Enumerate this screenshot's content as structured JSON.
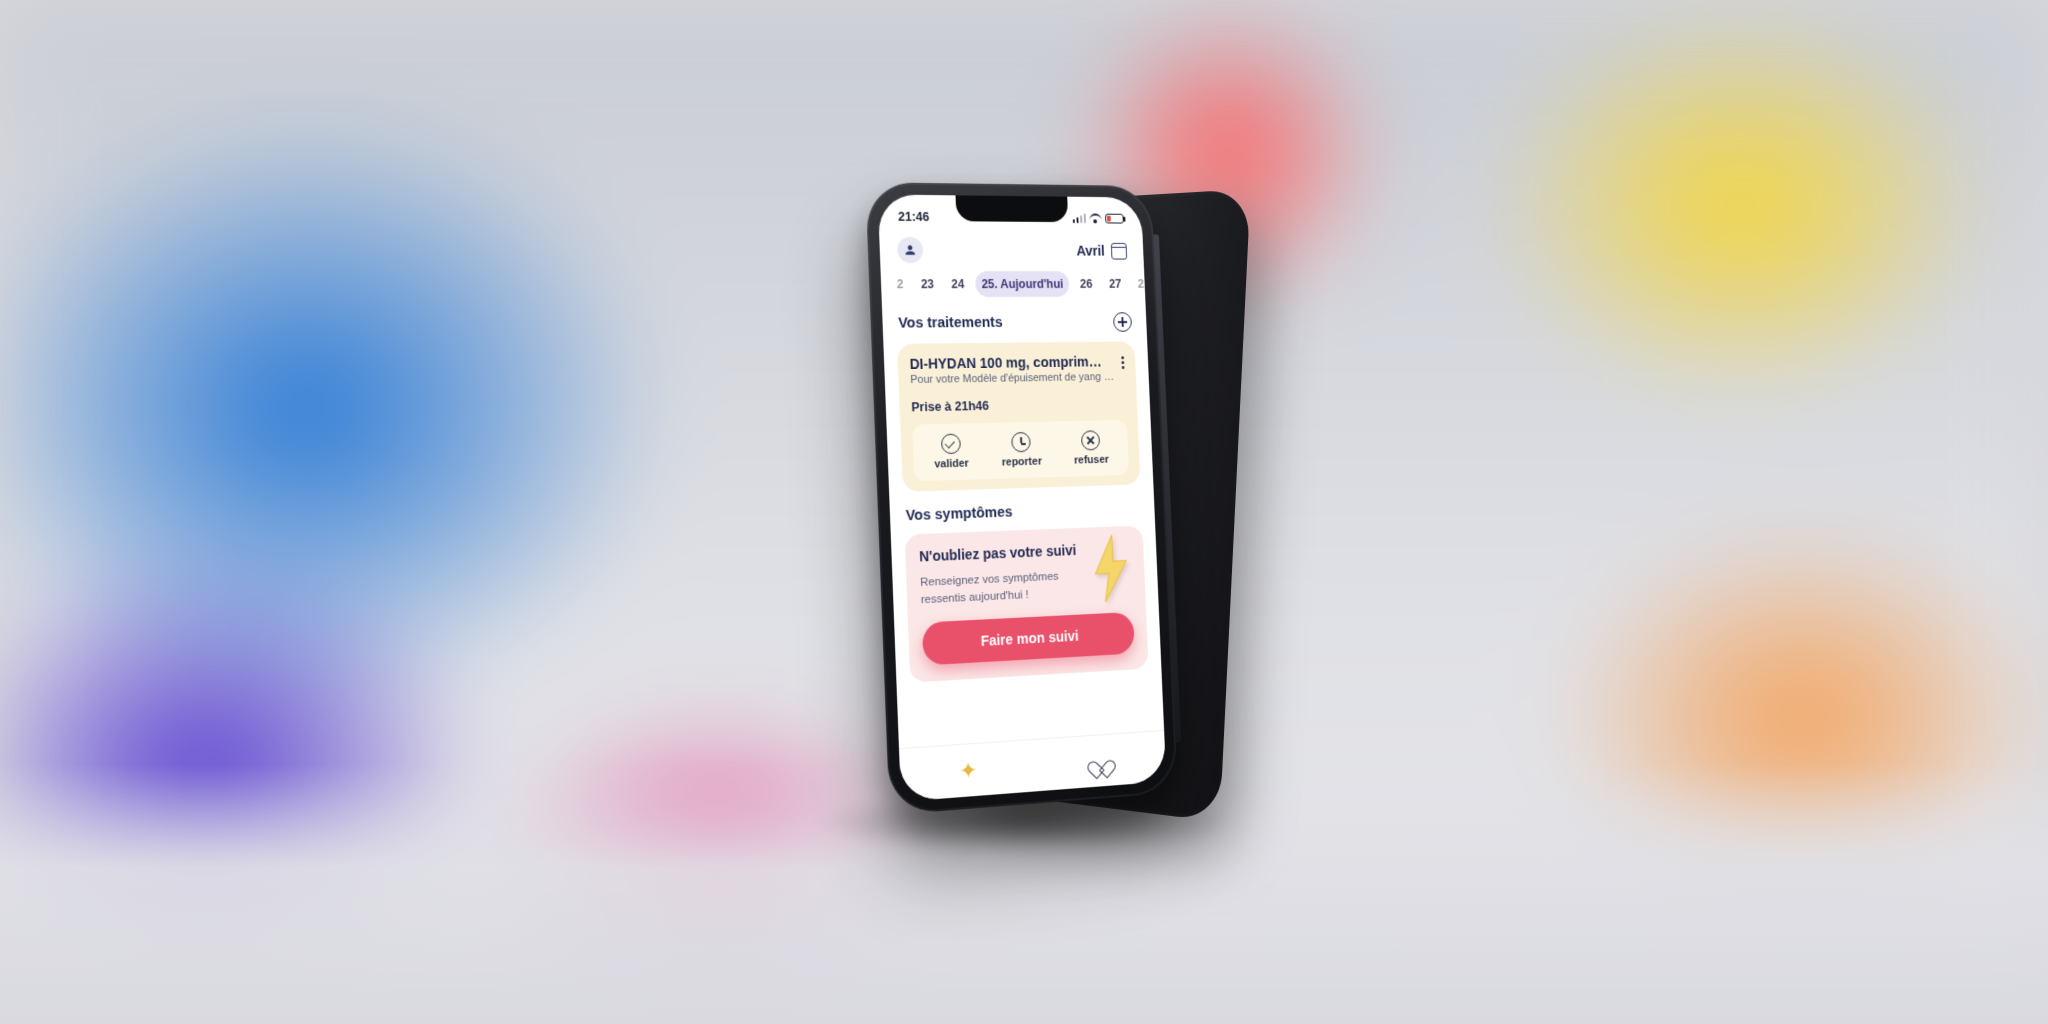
{
  "status": {
    "time": "21:46"
  },
  "header": {
    "month": "Avril"
  },
  "dates": {
    "items": [
      "2",
      "23",
      "24",
      "25. Aujourd'hui",
      "26",
      "27",
      "2"
    ],
    "active_index": 3
  },
  "treatments": {
    "heading": "Vos traitements",
    "card": {
      "title": "DI-HYDAN 100 mg, comprim…",
      "subtitle": "Pour votre Modèle d'épuisement de yang de t…",
      "time_label": "Prise à 21h46",
      "actions": {
        "validate": "valider",
        "postpone": "reporter",
        "refuse": "refuser"
      }
    }
  },
  "symptoms": {
    "heading": "Vos symptômes",
    "card": {
      "title": "N'oubliez pas votre suivi",
      "subtitle": "Renseignez vos symptômes ressentis aujourd'hui !",
      "cta": "Faire mon suivi"
    }
  }
}
